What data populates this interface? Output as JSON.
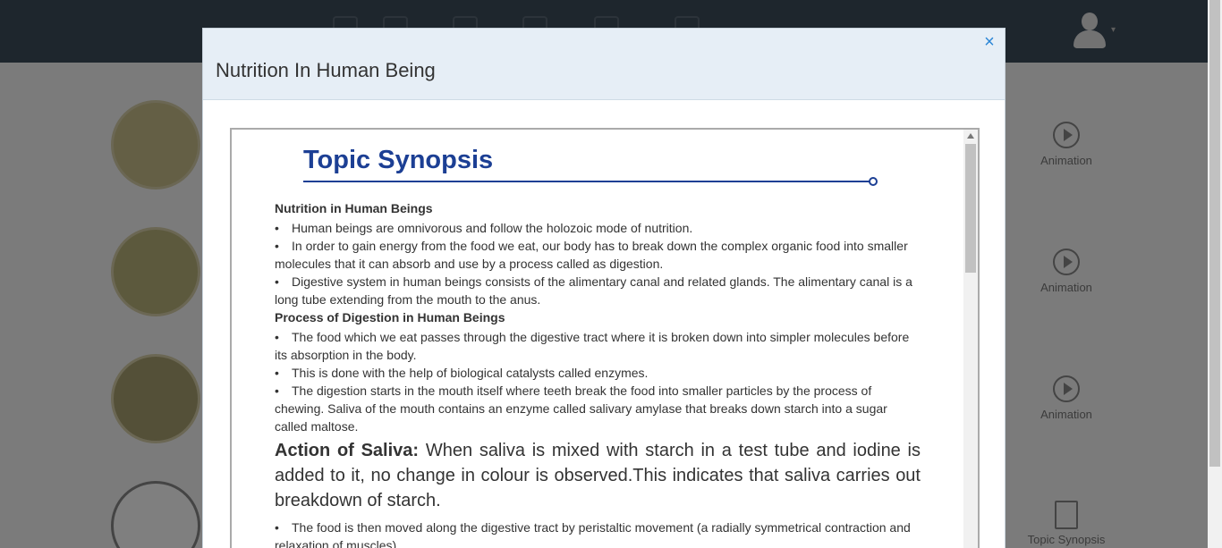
{
  "modal": {
    "title": "Nutrition In Human Being",
    "close_label": "×"
  },
  "synopsis": {
    "heading": "Topic Synopsis",
    "section1_title": "Nutrition in Human Beings",
    "section1_bullets": [
      "Human beings are omnivorous and follow the holozoic mode of nutrition.",
      "In order to gain energy from the food we eat, our body has to break down the complex organic food into smaller molecules that it can absorb and use by a process called as digestion.",
      "Digestive system in human beings consists of the alimentary canal and related glands. The alimentary canal is a long tube extending from the mouth to the anus."
    ],
    "section2_title": "Process of Digestion in Human Beings",
    "section2_bullets": [
      "The food which we eat passes through the digestive tract where it is broken down into simpler molecules before its absorption in the body.",
      "This is done with the help of biological catalysts called enzymes.",
      "The digestion starts in the mouth itself where teeth break the food into smaller particles by the process of chewing. Saliva of the mouth contains an enzyme called salivary amylase that breaks down starch into a sugar called maltose."
    ],
    "saliva_lead": "Action of Saliva:",
    "saliva_text": " When saliva is mixed with starch in a test tube and iodine is added to it, no change in colour is observed.This indicates that saliva carries out breakdown of starch.",
    "section3_bullets": [
      "The food is then moved along the digestive tract by peristaltic movement (a radially symmetrical contraction and relaxation of muscles)."
    ]
  },
  "background": {
    "animation_label": "Animation",
    "synopsis_label": "Topic Synopsis"
  }
}
